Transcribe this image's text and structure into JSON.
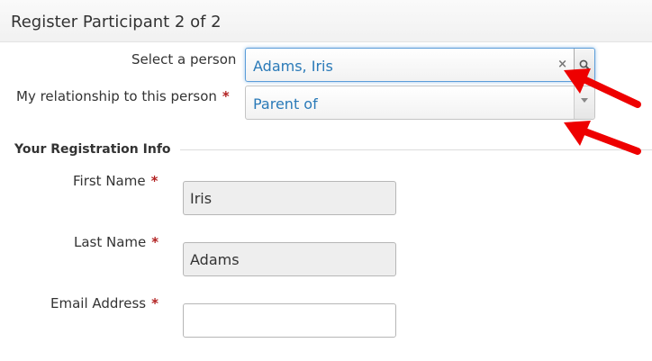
{
  "header": {
    "title": "Register Participant 2 of 2"
  },
  "person": {
    "label": "Select a person",
    "value": "Adams, Iris",
    "clear_icon": "×"
  },
  "relationship": {
    "label": "My relationship to this person",
    "required_mark": "*",
    "value": "Parent of"
  },
  "registration": {
    "legend": "Your Registration Info",
    "first_name": {
      "label": "First Name",
      "required_mark": "*",
      "value": "Iris"
    },
    "last_name": {
      "label": "Last Name",
      "required_mark": "*",
      "value": "Adams"
    },
    "email": {
      "label": "Email Address",
      "required_mark": "*",
      "value": ""
    }
  },
  "annotation_color": "#ee0000"
}
